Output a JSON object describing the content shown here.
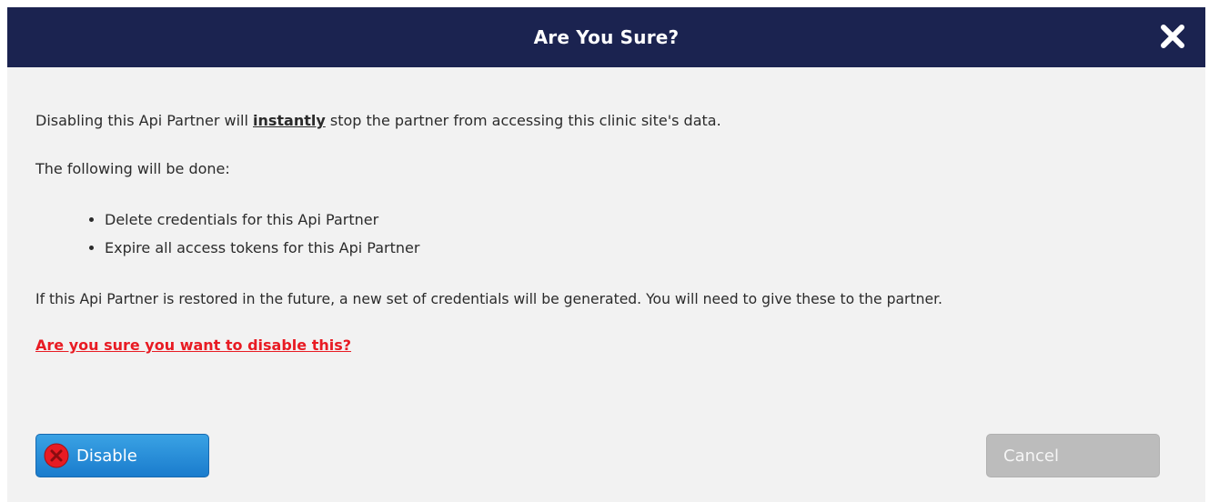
{
  "dialog": {
    "title": "Are You Sure?",
    "close_icon": "close-x-icon"
  },
  "body": {
    "line1_before": "Disabling this Api Partner will ",
    "line1_emphasis": "instantly",
    "line1_after": " stop the partner from accessing this clinic site's data.",
    "line2": "The following will be done:",
    "bullets": [
      "Delete credentials for this Api Partner",
      "Expire all access tokens for this Api Partner"
    ],
    "line3": "If this Api Partner is restored in the future, a new set of credentials will be generated. You will need to give these to the partner.",
    "warning": "Are you sure you want to disable this?"
  },
  "buttons": {
    "disable_label": "Disable",
    "disable_icon": "red-x-circle-icon",
    "cancel_label": "Cancel"
  },
  "colors": {
    "titlebar": "#1b2350",
    "warning": "#e81b23",
    "primary_button": "#1a7ccd",
    "cancel_button": "#bcbcbc",
    "background": "#f2f2f2"
  }
}
